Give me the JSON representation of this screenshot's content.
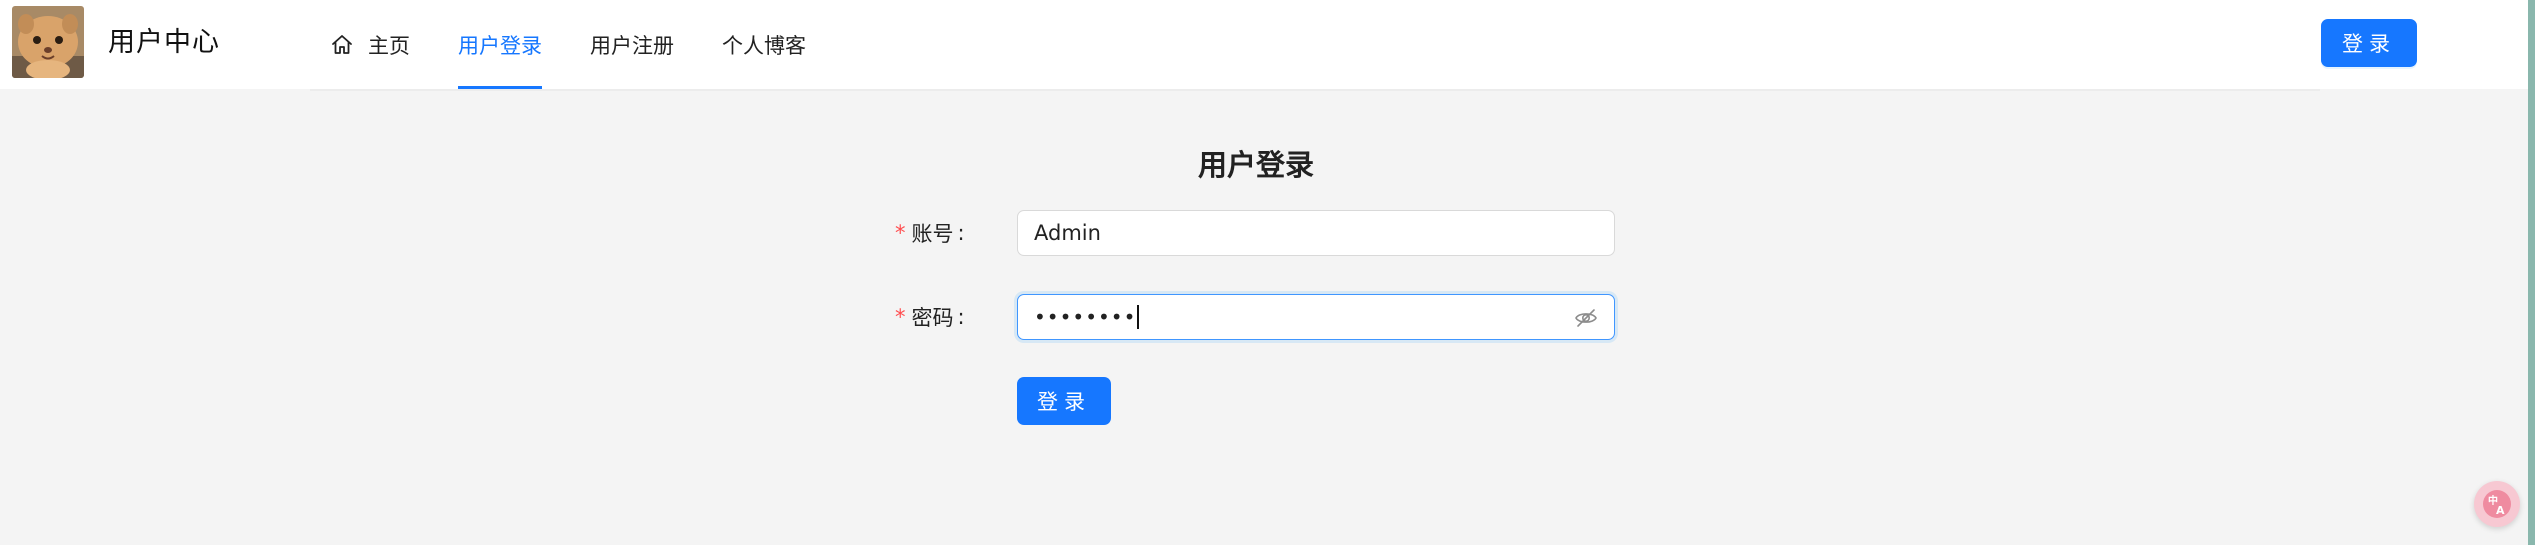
{
  "header": {
    "site_title": "用户中心",
    "login_button": "登录",
    "logo": "cat-avatar-logo",
    "nav": [
      {
        "label": "主页",
        "icon": "home-icon",
        "active": false
      },
      {
        "label": "用户登录",
        "active": true
      },
      {
        "label": "用户注册",
        "active": false
      },
      {
        "label": "个人博客",
        "active": false
      }
    ]
  },
  "form": {
    "title": "用户登录",
    "account_label": "账号",
    "account_value": "Admin",
    "password_label": "密码",
    "password_value": "••••••••",
    "submit_label": "登录",
    "required_mark": "*",
    "colon": ":"
  },
  "colors": {
    "primary": "#1677ff",
    "required": "#ff4d4f",
    "background": "#f4f4f4"
  },
  "widgets": {
    "translate_icon": "translate-icon"
  }
}
